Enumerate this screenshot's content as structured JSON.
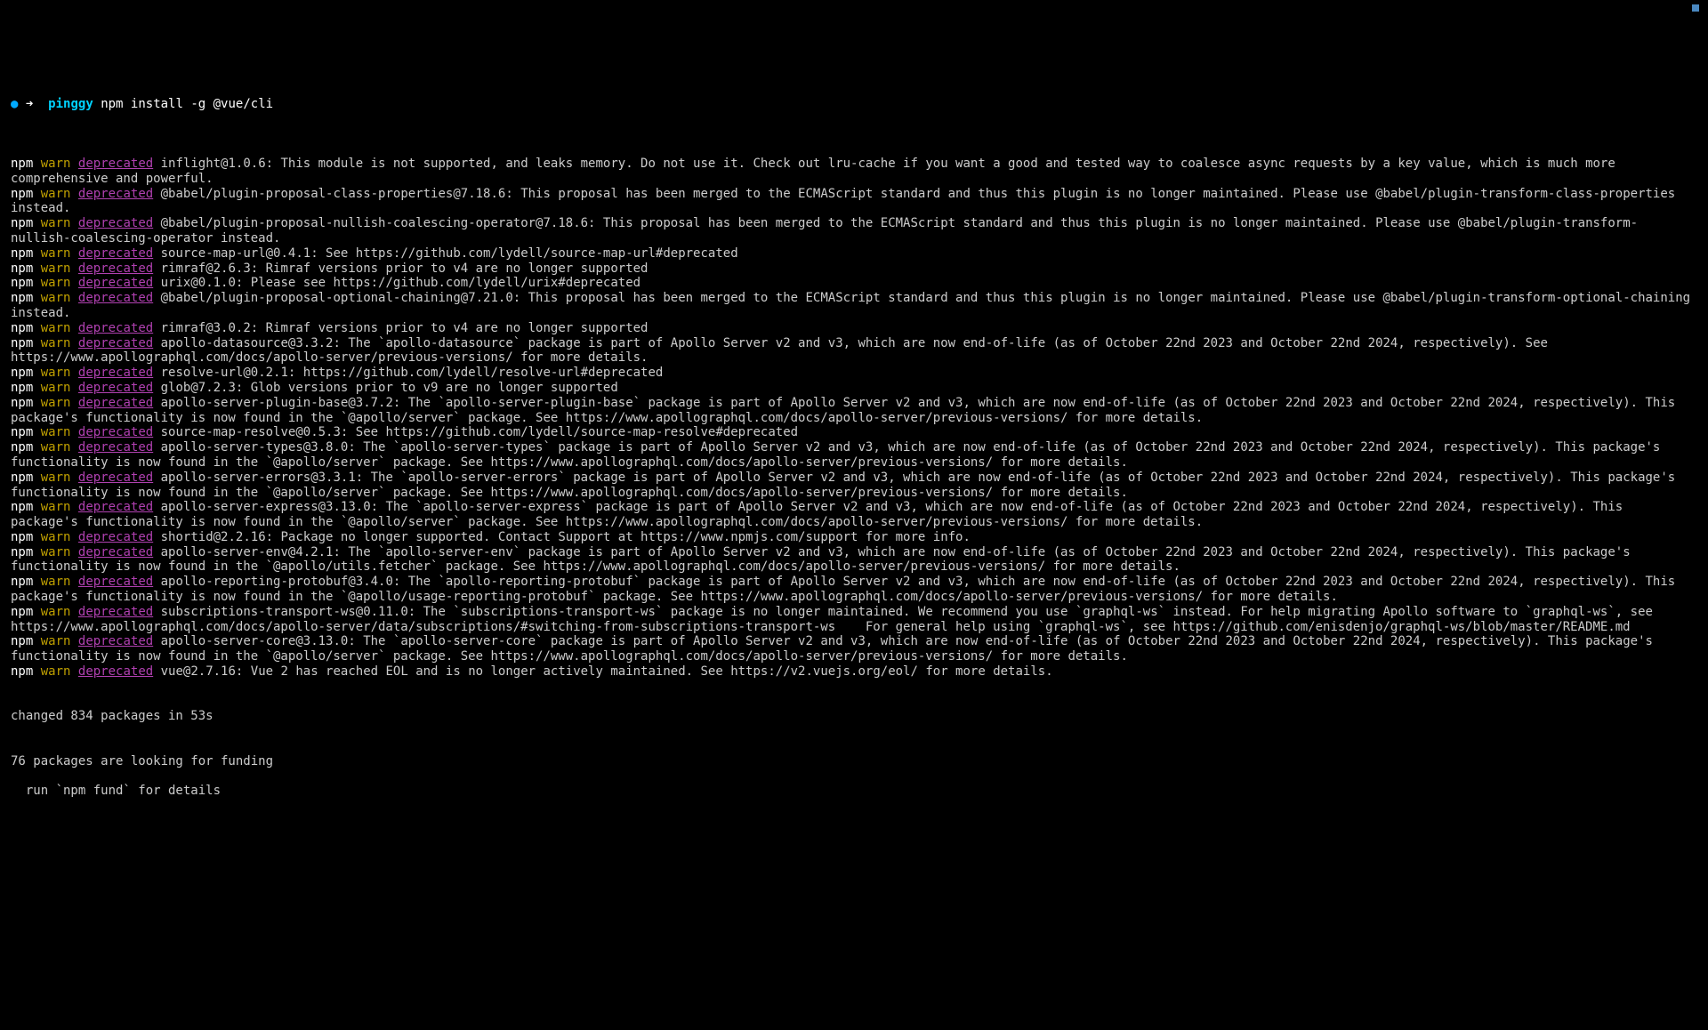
{
  "prompt": {
    "dot": "●",
    "arrow": "➜",
    "dir": "pinggy",
    "cmd": "npm install -g @vue/cli"
  },
  "lines": [
    {
      "type": "warn",
      "rest": " inflight@1.0.6: This module is not supported, and leaks memory. Do not use it. Check out lru-cache if you want a good and tested way to coalesce async requests by a key value, which is much more comprehensive and powerful."
    },
    {
      "type": "warn",
      "rest": " @babel/plugin-proposal-class-properties@7.18.6: This proposal has been merged to the ECMAScript standard and thus this plugin is no longer maintained. Please use @babel/plugin-transform-class-properties instead."
    },
    {
      "type": "warn",
      "rest": " @babel/plugin-proposal-nullish-coalescing-operator@7.18.6: This proposal has been merged to the ECMAScript standard and thus this plugin is no longer maintained. Please use @babel/plugin-transform-nullish-coalescing-operator instead."
    },
    {
      "type": "warn",
      "rest": " source-map-url@0.4.1: See https://github.com/lydell/source-map-url#deprecated"
    },
    {
      "type": "warn",
      "rest": " rimraf@2.6.3: Rimraf versions prior to v4 are no longer supported"
    },
    {
      "type": "warn",
      "rest": " urix@0.1.0: Please see https://github.com/lydell/urix#deprecated"
    },
    {
      "type": "warn",
      "rest": " @babel/plugin-proposal-optional-chaining@7.21.0: This proposal has been merged to the ECMAScript standard and thus this plugin is no longer maintained. Please use @babel/plugin-transform-optional-chaining instead."
    },
    {
      "type": "warn",
      "rest": " rimraf@3.0.2: Rimraf versions prior to v4 are no longer supported"
    },
    {
      "type": "warn",
      "rest": " apollo-datasource@3.3.2: The `apollo-datasource` package is part of Apollo Server v2 and v3, which are now end-of-life (as of October 22nd 2023 and October 22nd 2024, respectively). See https://www.apollographql.com/docs/apollo-server/previous-versions/ for more details."
    },
    {
      "type": "warn",
      "rest": " resolve-url@0.2.1: https://github.com/lydell/resolve-url#deprecated"
    },
    {
      "type": "warn",
      "rest": " glob@7.2.3: Glob versions prior to v9 are no longer supported"
    },
    {
      "type": "warn",
      "rest": " apollo-server-plugin-base@3.7.2: The `apollo-server-plugin-base` package is part of Apollo Server v2 and v3, which are now end-of-life (as of October 22nd 2023 and October 22nd 2024, respectively). This package's functionality is now found in the `@apollo/server` package. See https://www.apollographql.com/docs/apollo-server/previous-versions/ for more details."
    },
    {
      "type": "warn",
      "rest": " source-map-resolve@0.5.3: See https://github.com/lydell/source-map-resolve#deprecated"
    },
    {
      "type": "warn",
      "rest": " apollo-server-types@3.8.0: The `apollo-server-types` package is part of Apollo Server v2 and v3, which are now end-of-life (as of October 22nd 2023 and October 22nd 2024, respectively). This package's functionality is now found in the `@apollo/server` package. See https://www.apollographql.com/docs/apollo-server/previous-versions/ for more details."
    },
    {
      "type": "warn",
      "rest": " apollo-server-errors@3.3.1: The `apollo-server-errors` package is part of Apollo Server v2 and v3, which are now end-of-life (as of October 22nd 2023 and October 22nd 2024, respectively). This package's functionality is now found in the `@apollo/server` package. See https://www.apollographql.com/docs/apollo-server/previous-versions/ for more details."
    },
    {
      "type": "warn",
      "rest": " apollo-server-express@3.13.0: The `apollo-server-express` package is part of Apollo Server v2 and v3, which are now end-of-life (as of October 22nd 2023 and October 22nd 2024, respectively). This package's functionality is now found in the `@apollo/server` package. See https://www.apollographql.com/docs/apollo-server/previous-versions/ for more details."
    },
    {
      "type": "warn",
      "rest": " shortid@2.2.16: Package no longer supported. Contact Support at https://www.npmjs.com/support for more info."
    },
    {
      "type": "warn",
      "rest": " apollo-server-env@4.2.1: The `apollo-server-env` package is part of Apollo Server v2 and v3, which are now end-of-life (as of October 22nd 2023 and October 22nd 2024, respectively). This package's functionality is now found in the `@apollo/utils.fetcher` package. See https://www.apollographql.com/docs/apollo-server/previous-versions/ for more details."
    },
    {
      "type": "warn",
      "rest": " apollo-reporting-protobuf@3.4.0: The `apollo-reporting-protobuf` package is part of Apollo Server v2 and v3, which are now end-of-life (as of October 22nd 2023 and October 22nd 2024, respectively). This package's functionality is now found in the `@apollo/usage-reporting-protobuf` package. See https://www.apollographql.com/docs/apollo-server/previous-versions/ for more details."
    },
    {
      "type": "warn",
      "rest": " subscriptions-transport-ws@0.11.0: The `subscriptions-transport-ws` package is no longer maintained. We recommend you use `graphql-ws` instead. For help migrating Apollo software to `graphql-ws`, see https://www.apollographql.com/docs/apollo-server/data/subscriptions/#switching-from-subscriptions-transport-ws    For general help using `graphql-ws`, see https://github.com/enisdenjo/graphql-ws/blob/master/README.md"
    },
    {
      "type": "warn",
      "rest": " apollo-server-core@3.13.0: The `apollo-server-core` package is part of Apollo Server v2 and v3, which are now end-of-life (as of October 22nd 2023 and October 22nd 2024, respectively). This package's functionality is now found in the `@apollo/server` package. See https://www.apollographql.com/docs/apollo-server/previous-versions/ for more details."
    },
    {
      "type": "warn",
      "rest": " vue@2.7.16: Vue 2 has reached EOL and is no longer actively maintained. See https://v2.vuejs.org/eol/ for more details."
    }
  ],
  "footer": {
    "blank": "",
    "changed": "changed 834 packages in 53s",
    "blank2": "",
    "funding": "76 packages are looking for funding",
    "run": "  run `npm fund` for details"
  },
  "tokens": {
    "npm": "npm",
    "warn": "warn",
    "deprecated": "deprecated"
  }
}
